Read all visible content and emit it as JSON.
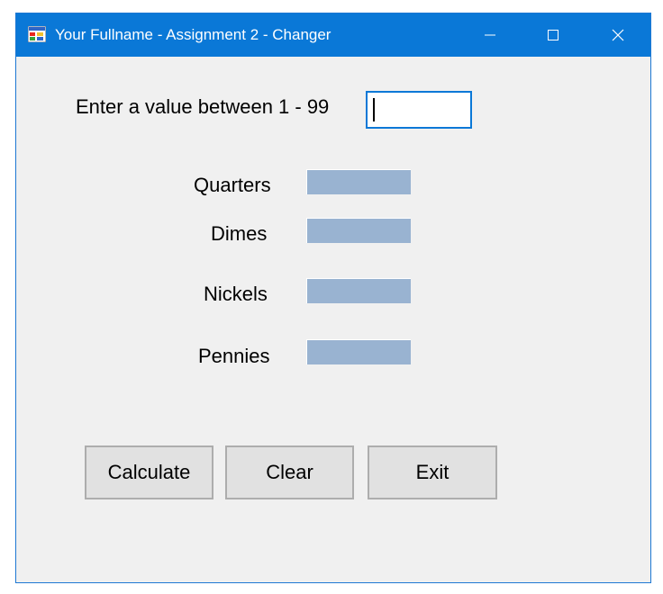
{
  "window": {
    "title": "Your Fullname - Assignment 2 - Changer",
    "accent_color": "#0a78d7",
    "icon": "windows-form-icon",
    "controls": {
      "minimize_icon": "minimize-icon",
      "maximize_icon": "maximize-icon",
      "close_icon": "close-icon"
    }
  },
  "form": {
    "prompt_label": "Enter a value between 1 - 99",
    "input": {
      "value": "",
      "placeholder": ""
    },
    "outputs": [
      {
        "label": "Quarters",
        "value": ""
      },
      {
        "label": "Dimes",
        "value": ""
      },
      {
        "label": "Nickels",
        "value": ""
      },
      {
        "label": "Pennies",
        "value": ""
      }
    ],
    "output_box_color": "#99b3d1"
  },
  "buttons": {
    "calculate_label": "Calculate",
    "clear_label": "Clear",
    "exit_label": "Exit"
  }
}
